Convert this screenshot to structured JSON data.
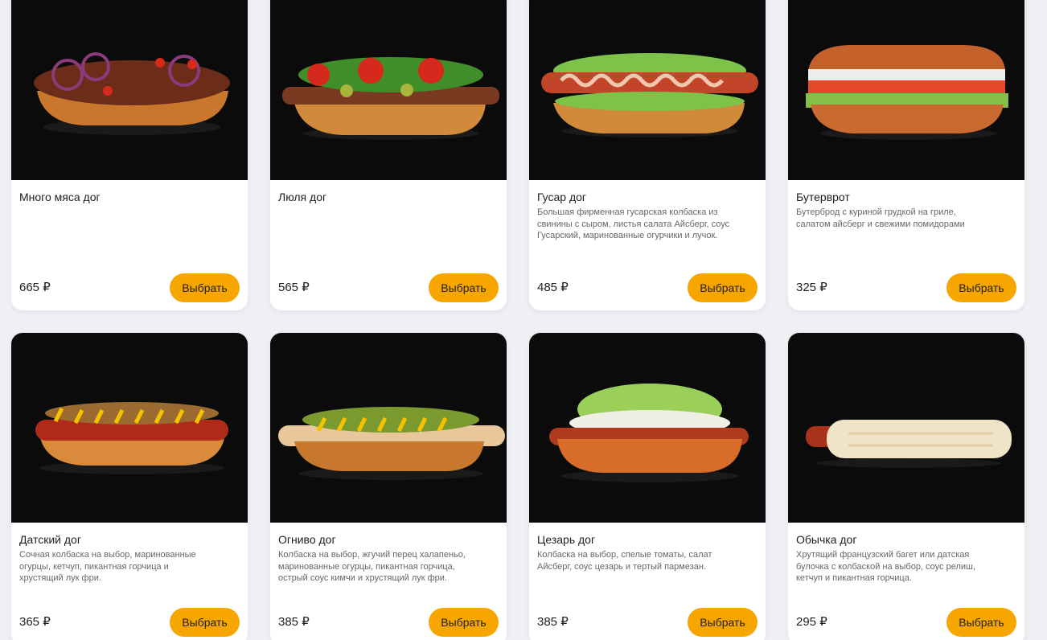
{
  "currency": "₽",
  "button_label": "Выбрать",
  "products": [
    {
      "name": "Много мяса дог",
      "description": "",
      "price": "665 ₽"
    },
    {
      "name": "Люля дог",
      "description": "",
      "price": "565 ₽"
    },
    {
      "name": "Гусар дог",
      "description": "Большая фирменная гусарская колбаска из  свинины с сыром, листья салата Айсберг, соус Гусарский, маринованные огурчики и лучок.",
      "price": "485 ₽"
    },
    {
      "name": "Бутерврот",
      "description": "Бутерброд с куриной грудкой на гриле, салатом айсберг и свежими помидорами",
      "price": "325 ₽"
    },
    {
      "name": "Датский дог",
      "description": "Сочная колбаска на выбор, маринованные огурцы, кетчуп, пикантная горчица и хрустящий лук фри.",
      "price": "365 ₽"
    },
    {
      "name": "Огниво дог",
      "description": "Колбаска на выбор, жгучий перец халапеньо, маринованные огурцы, пикантная горчица, острый соус кимчи и хрустящий лук фри.",
      "price": "385 ₽"
    },
    {
      "name": "Цезарь дог",
      "description": "Колбаска на выбор, спелые томаты, салат Айсберг, соус цезарь и тертый пармезан.",
      "price": "385 ₽"
    },
    {
      "name": "Обычка дог",
      "description": "Хрутящий французский багет или датская булочка с колбаской на выбор, соус релиш, кетчуп и пикантная горчица.",
      "price": "295 ₽"
    }
  ],
  "colors": {
    "accent": "#f7a600",
    "background": "#eef0f5",
    "photo_bg": "#0b0b0b"
  }
}
